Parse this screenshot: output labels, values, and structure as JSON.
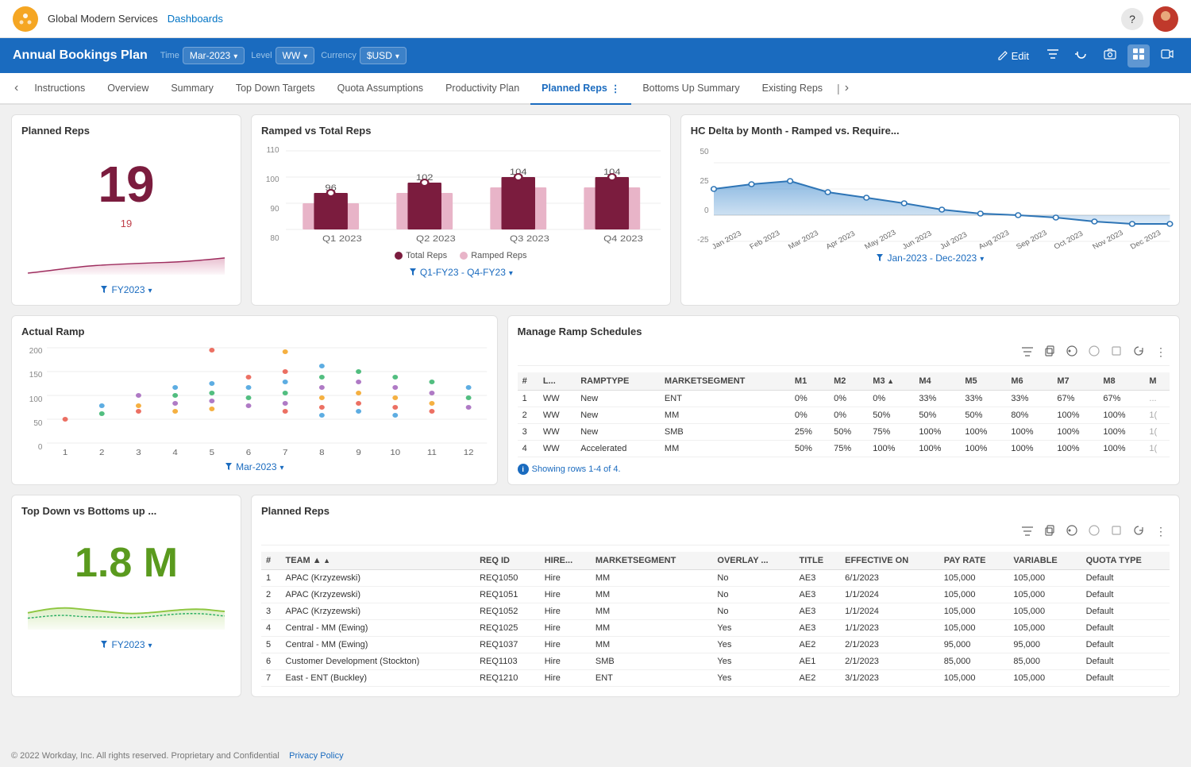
{
  "app": {
    "logo": "W",
    "company": "Global Modern Services",
    "nav_link": "Dashboards",
    "help_icon": "?",
    "footer": "© 2022 Workday, Inc. All rights reserved. Proprietary and Confidential",
    "footer_link": "Privacy Policy"
  },
  "toolbar": {
    "title": "Annual Bookings Plan",
    "time_label": "Time",
    "time_value": "Mar-2023",
    "level_label": "Level",
    "level_value": "WW",
    "currency_label": "Currency",
    "currency_value": "$USD",
    "edit_label": "Edit",
    "icons": [
      "pencil",
      "filter",
      "refresh",
      "camera",
      "grid",
      "video"
    ]
  },
  "tabs": {
    "items": [
      {
        "label": "Instructions",
        "active": false
      },
      {
        "label": "Overview",
        "active": false
      },
      {
        "label": "Summary",
        "active": false
      },
      {
        "label": "Top Down Targets",
        "active": false
      },
      {
        "label": "Quota Assumptions",
        "active": false
      },
      {
        "label": "Productivity Plan",
        "active": false
      },
      {
        "label": "Planned Reps",
        "active": true
      },
      {
        "label": "Bottoms Up Summary",
        "active": false
      },
      {
        "label": "Existing Reps",
        "active": false
      }
    ]
  },
  "planned_reps_card": {
    "title": "Planned Reps",
    "value": "19",
    "sub_value": "19",
    "footer_label": "FY2023",
    "footer_icon": "filter"
  },
  "ramped_reps_card": {
    "title": "Ramped vs Total Reps",
    "footer_label": "Q1-FY23 - Q4-FY23",
    "legend_total": "Total Reps",
    "legend_ramped": "Ramped Reps",
    "quarters": [
      "Q1 2023",
      "Q2 2023",
      "Q3 2023",
      "Q4 2023"
    ],
    "total_values": [
      96,
      102,
      104,
      104
    ],
    "ramped_values": [
      90,
      96,
      100,
      100
    ],
    "y_labels": [
      "80",
      "90",
      "100",
      "110"
    ]
  },
  "hc_delta_card": {
    "title": "HC Delta by Month - Ramped vs. Require...",
    "footer_label": "Jan-2023 - Dec-2023",
    "y_labels": [
      "-25",
      "0",
      "25",
      "50"
    ],
    "x_labels": [
      "Jan 2023",
      "Feb 2023",
      "Mar 2023",
      "Apr 2023",
      "May 2023",
      "Jun 2023",
      "Jul 2023",
      "Aug 2023",
      "Sep 2023",
      "Oct 2023",
      "Nov 2023",
      "Dec 2023"
    ]
  },
  "actual_ramp_card": {
    "title": "Actual Ramp",
    "footer_label": "Mar-2023",
    "y_labels": [
      "0",
      "50",
      "100",
      "150",
      "200"
    ],
    "x_labels": [
      "1",
      "2",
      "3",
      "4",
      "5",
      "6",
      "7",
      "8",
      "9",
      "10",
      "11",
      "12"
    ]
  },
  "manage_ramp_card": {
    "title": "Manage Ramp Schedules",
    "table": {
      "columns": [
        "#",
        "L...",
        "RAMPTYPE",
        "MARKETSEGMENT",
        "M1",
        "M2",
        "M3",
        "M4",
        "M5",
        "M6",
        "M7",
        "M8",
        "M"
      ],
      "sort_col": "M3",
      "rows": [
        {
          "num": "1",
          "l": "WW",
          "ramptype": "New",
          "market": "ENT",
          "m1": "0%",
          "m2": "0%",
          "m3": "0%",
          "m4": "33%",
          "m5": "33%",
          "m6": "33%",
          "m7": "67%",
          "m8": "67%",
          "m": "..."
        },
        {
          "num": "2",
          "l": "WW",
          "ramptype": "New",
          "market": "MM",
          "m1": "0%",
          "m2": "0%",
          "m3": "50%",
          "m4": "50%",
          "m5": "50%",
          "m6": "80%",
          "m7": "100%",
          "m8": "100%",
          "m": "1("
        },
        {
          "num": "3",
          "l": "WW",
          "ramptype": "New",
          "market": "SMB",
          "m1": "25%",
          "m2": "50%",
          "m3": "75%",
          "m4": "100%",
          "m5": "100%",
          "m6": "100%",
          "m7": "100%",
          "m8": "100%",
          "m": "1("
        },
        {
          "num": "4",
          "l": "WW",
          "ramptype": "Accelerated",
          "market": "MM",
          "m1": "50%",
          "m2": "75%",
          "m3": "100%",
          "m4": "100%",
          "m5": "100%",
          "m6": "100%",
          "m7": "100%",
          "m8": "100%",
          "m": "1("
        }
      ],
      "rows_info": "Showing rows 1-4 of 4."
    }
  },
  "top_down_card": {
    "title": "Top Down vs Bottoms up ...",
    "value": "1.8 M",
    "footer_label": "FY2023"
  },
  "planned_reps_table_card": {
    "title": "Planned Reps",
    "table": {
      "columns": [
        "#",
        "TEAM",
        "REQ ID",
        "HIRE...",
        "MARKETSEGMENT",
        "OVERLAY ...",
        "TITLE",
        "EFFECTIVE ON",
        "PAY RATE",
        "VARIABLE",
        "QUOTA TYPE"
      ],
      "sort_col": "TEAM",
      "rows": [
        {
          "num": "1",
          "team": "APAC (Krzyzewski)",
          "req": "REQ1050",
          "hire": "Hire",
          "market": "MM",
          "overlay": "No",
          "title": "AE3",
          "effective": "6/1/2023",
          "pay": "105,000",
          "variable": "105,000",
          "quota": "Default"
        },
        {
          "num": "2",
          "team": "APAC (Krzyzewski)",
          "req": "REQ1051",
          "hire": "Hire",
          "market": "MM",
          "overlay": "No",
          "title": "AE3",
          "effective": "1/1/2024",
          "pay": "105,000",
          "variable": "105,000",
          "quota": "Default"
        },
        {
          "num": "3",
          "team": "APAC (Krzyzewski)",
          "req": "REQ1052",
          "hire": "Hire",
          "market": "MM",
          "overlay": "No",
          "title": "AE3",
          "effective": "1/1/2024",
          "pay": "105,000",
          "variable": "105,000",
          "quota": "Default"
        },
        {
          "num": "4",
          "team": "Central - MM (Ewing)",
          "req": "REQ1025",
          "hire": "Hire",
          "market": "MM",
          "overlay": "Yes",
          "title": "AE3",
          "effective": "1/1/2023",
          "pay": "105,000",
          "variable": "105,000",
          "quota": "Default"
        },
        {
          "num": "5",
          "team": "Central - MM (Ewing)",
          "req": "REQ1037",
          "hire": "Hire",
          "market": "MM",
          "overlay": "Yes",
          "title": "AE2",
          "effective": "2/1/2023",
          "pay": "95,000",
          "variable": "95,000",
          "quota": "Default"
        },
        {
          "num": "6",
          "team": "Customer Development (Stockton)",
          "req": "REQ1103",
          "hire": "Hire",
          "market": "SMB",
          "overlay": "Yes",
          "title": "AE1",
          "effective": "2/1/2023",
          "pay": "85,000",
          "variable": "85,000",
          "quota": "Default"
        },
        {
          "num": "7",
          "team": "East - ENT (Buckley)",
          "req": "REQ1210",
          "hire": "Hire",
          "market": "ENT",
          "overlay": "Yes",
          "title": "AE2",
          "effective": "3/1/2023",
          "pay": "105,000",
          "variable": "105,000",
          "quota": "Default"
        }
      ]
    }
  }
}
